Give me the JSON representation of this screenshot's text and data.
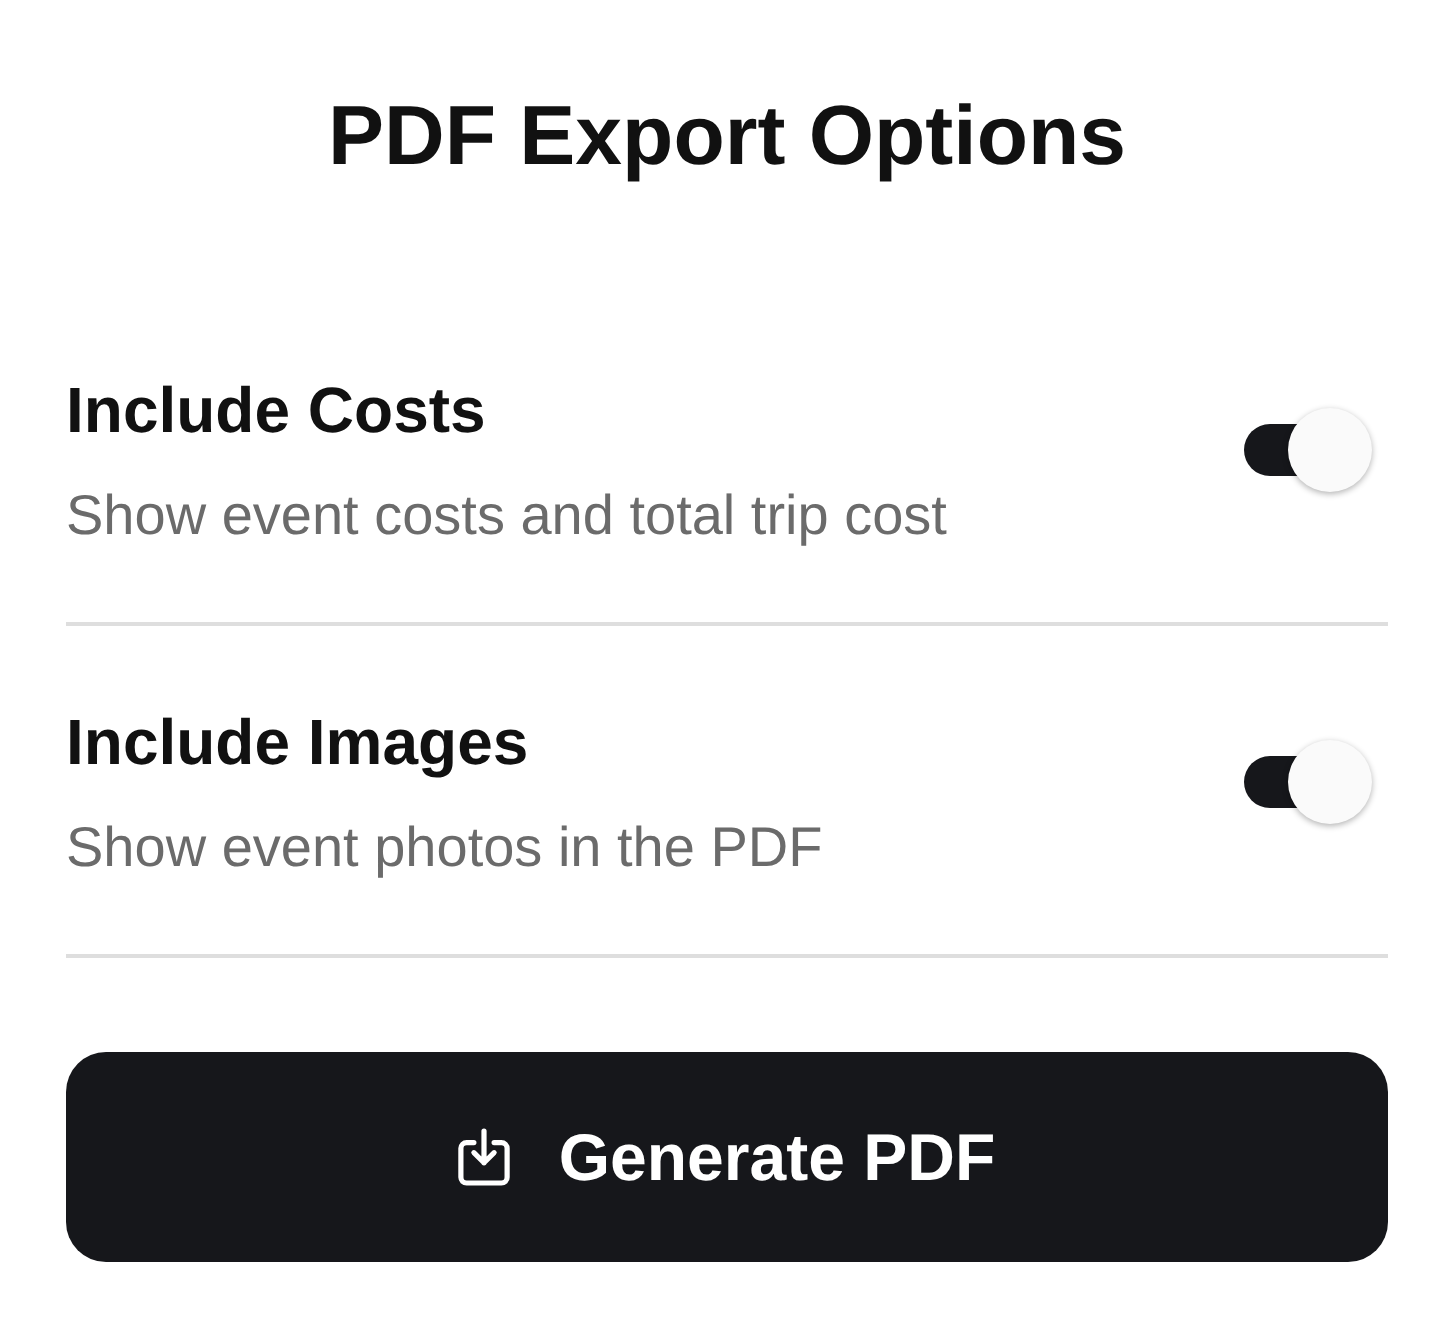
{
  "title": "PDF Export Options",
  "options": [
    {
      "label": "Include Costs",
      "description": "Show event costs and total trip cost",
      "on": true
    },
    {
      "label": "Include Images",
      "description": "Show event photos in the PDF",
      "on": true
    }
  ],
  "button": {
    "label": "Generate PDF"
  }
}
